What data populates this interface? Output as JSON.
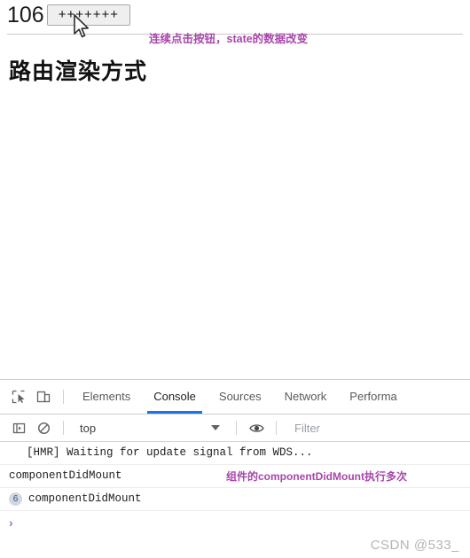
{
  "page": {
    "counter_value": "106",
    "increment_button_label": "+++++++",
    "heading": "路由渲染方式",
    "annotation_top": "连续点击按钮，state的数据改变",
    "cursor_icon": "arrow-cursor-icon"
  },
  "devtools": {
    "toolbar_icons": [
      {
        "name": "inspect-element-icon",
        "title": "Inspect element"
      },
      {
        "name": "device-toolbar-icon",
        "title": "Toggle device toolbar"
      }
    ],
    "tabs": [
      {
        "label": "Elements",
        "active": false
      },
      {
        "label": "Console",
        "active": true
      },
      {
        "label": "Sources",
        "active": false
      },
      {
        "label": "Network",
        "active": false
      },
      {
        "label": "Performa",
        "active": false
      }
    ],
    "active_tab_underline_color": "#1a73e8",
    "console_toolbar": {
      "sidebar_toggle_icon": "console-sidebar-icon",
      "clear_icon": "clear-console-icon",
      "context_selected": "top",
      "context_caret_icon": "chevron-down-icon",
      "eye_icon": "live-expression-eye-icon",
      "filter_placeholder": "Filter",
      "filter_value": ""
    },
    "logs": [
      {
        "badge": "",
        "text": "[HMR] Waiting for update signal from WDS...",
        "indent": true
      },
      {
        "badge": "",
        "text": "componentDidMount",
        "indent": false
      },
      {
        "badge": "6",
        "text": "componentDidMount",
        "indent": false
      }
    ],
    "annotation_console": "组件的componentDidMount执行多次",
    "prompt_symbol": "›"
  },
  "watermark": "CSDN @533_",
  "colors": {
    "annotation": "#a846ab",
    "tab_active": "#1a73e8",
    "badge_bg": "#cfd8e3",
    "prompt": "#6f86d6"
  }
}
